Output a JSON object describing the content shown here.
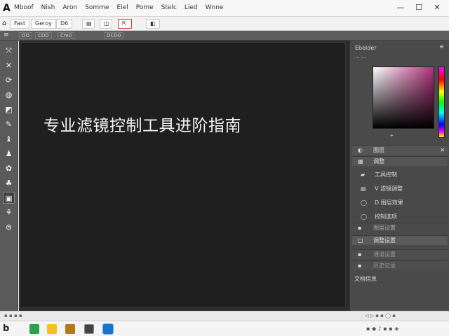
{
  "app": {
    "logo": "A",
    "title": "Mboof"
  },
  "menus": [
    "Mboof",
    "Nish",
    "Aron",
    "Somme",
    "Eiel",
    "Pome",
    "Stelc",
    "Lied",
    "Wnne"
  ],
  "options_bar": {
    "buttons": [
      "Fast",
      "Geroy",
      "D6",
      "",
      "",
      "",
      ""
    ]
  },
  "strip": {
    "items": [
      "",
      "OO",
      "CDD",
      "Cm0",
      "OCD0"
    ]
  },
  "tools": [
    {
      "icon": "move-icon",
      "glyph": "⤧"
    },
    {
      "icon": "lasso-icon",
      "glyph": "✕"
    },
    {
      "icon": "crop-icon",
      "glyph": "⟳"
    },
    {
      "icon": "eyedropper-icon",
      "glyph": "◍"
    },
    {
      "icon": "brush-icon",
      "glyph": "◩"
    },
    {
      "icon": "clone-icon",
      "glyph": "✎"
    },
    {
      "icon": "eraser-icon",
      "glyph": "♝"
    },
    {
      "icon": "gradient-icon",
      "glyph": "♟"
    },
    {
      "icon": "blur-icon",
      "glyph": "✿"
    },
    {
      "icon": "pen-icon",
      "glyph": "♣"
    },
    {
      "icon": "type-icon",
      "glyph": "▣"
    },
    {
      "icon": "shape-icon",
      "glyph": "⚘"
    },
    {
      "icon": "zoom-icon",
      "glyph": "⊜"
    }
  ],
  "canvas": {
    "text": "专业滤镜控制工具进阶指南"
  },
  "panel": {
    "title": "Ebolder",
    "subtitle": "··· ···",
    "rows": [
      {
        "icon": "◐",
        "label": "图层"
      },
      {
        "icon": "▦",
        "label": "调整"
      }
    ],
    "subrows": [
      {
        "icon": "▰",
        "label": "工具控制"
      },
      {
        "icon": "▤",
        "label": "V 滤镜调整"
      },
      {
        "icon": "◯",
        "label": "D 图层效果"
      },
      {
        "icon": "◯",
        "label": "控制选项"
      }
    ],
    "lower_rows": [
      {
        "icon": "▪",
        "label": "图层设置"
      },
      {
        "icon": "□",
        "label": "调整设置"
      },
      {
        "icon": "▪",
        "label": "通道设置"
      },
      {
        "icon": "▪",
        "label": "历史记录"
      }
    ],
    "footer": "文档信息"
  },
  "status": {
    "items": [
      "▪ ▪ ▪ ▪",
      "◁ ▷ ▪ ▪ ◯ ▪"
    ]
  },
  "taskbar": {
    "apps": [
      {
        "icon": "app-b-icon",
        "color": "#333"
      },
      {
        "icon": "green-app-icon",
        "color": "#2aa14a"
      },
      {
        "icon": "folder-yellow-icon",
        "color": "#f5c21b"
      },
      {
        "icon": "files-icon",
        "color": "#b07a1c"
      },
      {
        "icon": "image-editor-icon",
        "color": "#444"
      },
      {
        "icon": "photo-app-icon",
        "color": "#1a73c8"
      }
    ],
    "tray": "▪ ◆ ♪ ▪ ▪ ◈"
  }
}
